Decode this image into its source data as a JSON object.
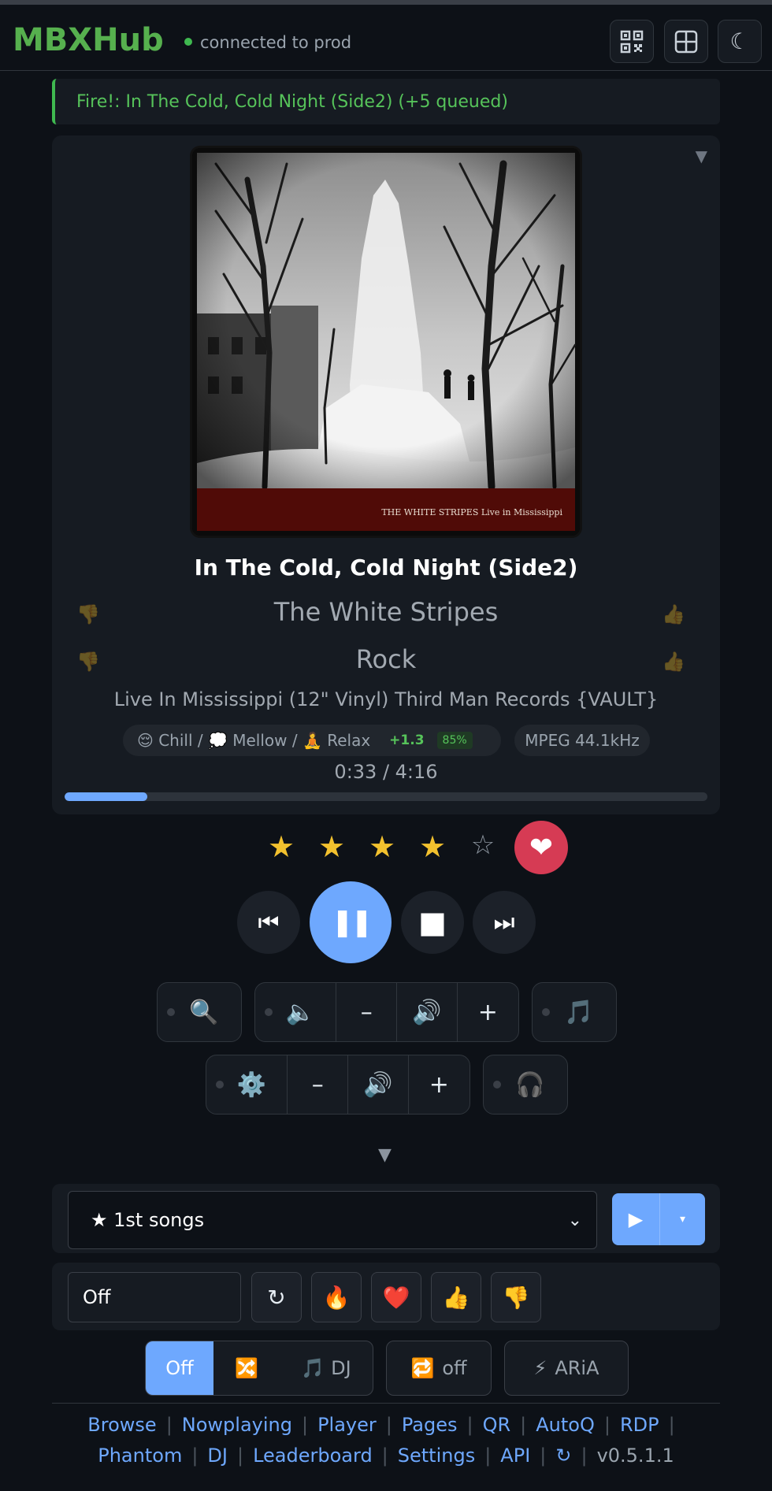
{
  "header": {
    "brand": "MBXHub",
    "connection": "connected to prod",
    "buttons": [
      "qr-code",
      "layout-grid",
      "theme-moon"
    ]
  },
  "banner": {
    "text": "Fire!: In The Cold, Cold Night (Side2) (+5 queued)"
  },
  "now_playing": {
    "cover_caption": "THE WHITE STRIPES Live in Mississippi",
    "title": "In The Cold, Cold Night (Side2)",
    "artist": "The White Stripes",
    "genre": "Rock",
    "album": "Live In Mississippi (12\" Vinyl) Third Man Records {VAULT}",
    "mood_text": "😌 Chill / 💭 Mellow / 🧘 Relax",
    "mood_score": "+1.3",
    "mood_confidence": "85%",
    "format": "MPEG 44.1kHz",
    "time": "0:33 / 4:16",
    "progress_fraction": 0.129
  },
  "rating": {
    "stars": 4,
    "max": 5,
    "loved": true
  },
  "transport": {
    "prev": "⏮",
    "pause": "❚❚",
    "stop": "■",
    "next": "⏭"
  },
  "controls": {
    "row1": {
      "search_icon": "🔍",
      "speaker_icon": "🔈",
      "minus": "–",
      "volume_icon": "🔊",
      "plus": "+",
      "music_icon": "🎵"
    },
    "row2": {
      "gear_icon": "⚙️",
      "minus": "–",
      "volume_icon": "🔊",
      "plus": "+",
      "headphones_icon": "🎧"
    }
  },
  "expand_arrow": "▼",
  "playlist": {
    "selected": "★ 1st songs",
    "play": "▶",
    "menu": "▾"
  },
  "autoq": {
    "value": "Off",
    "buttons": [
      "↻",
      "🔥",
      "❤️",
      "👍",
      "👎"
    ]
  },
  "modes": {
    "shuffle": {
      "off": "Off",
      "shuffle_icon": "🔀",
      "dj_icon": "🎵",
      "dj": "DJ"
    },
    "repeat": {
      "icon": "🔁",
      "label": "off"
    },
    "aria": {
      "icon": "⚡",
      "label": "ARiA"
    }
  },
  "footer": {
    "links": [
      "Browse",
      "Nowplaying",
      "Player",
      "Pages",
      "QR",
      "AutoQ",
      "RDP",
      "Phantom",
      "DJ",
      "Leaderboard",
      "Settings",
      "API",
      "↻"
    ],
    "version": "v0.5.1.1"
  },
  "colors": {
    "accent": "#6ea8fe",
    "brand": "#56b04e",
    "love": "#d63b54",
    "star": "#f2c12e"
  }
}
